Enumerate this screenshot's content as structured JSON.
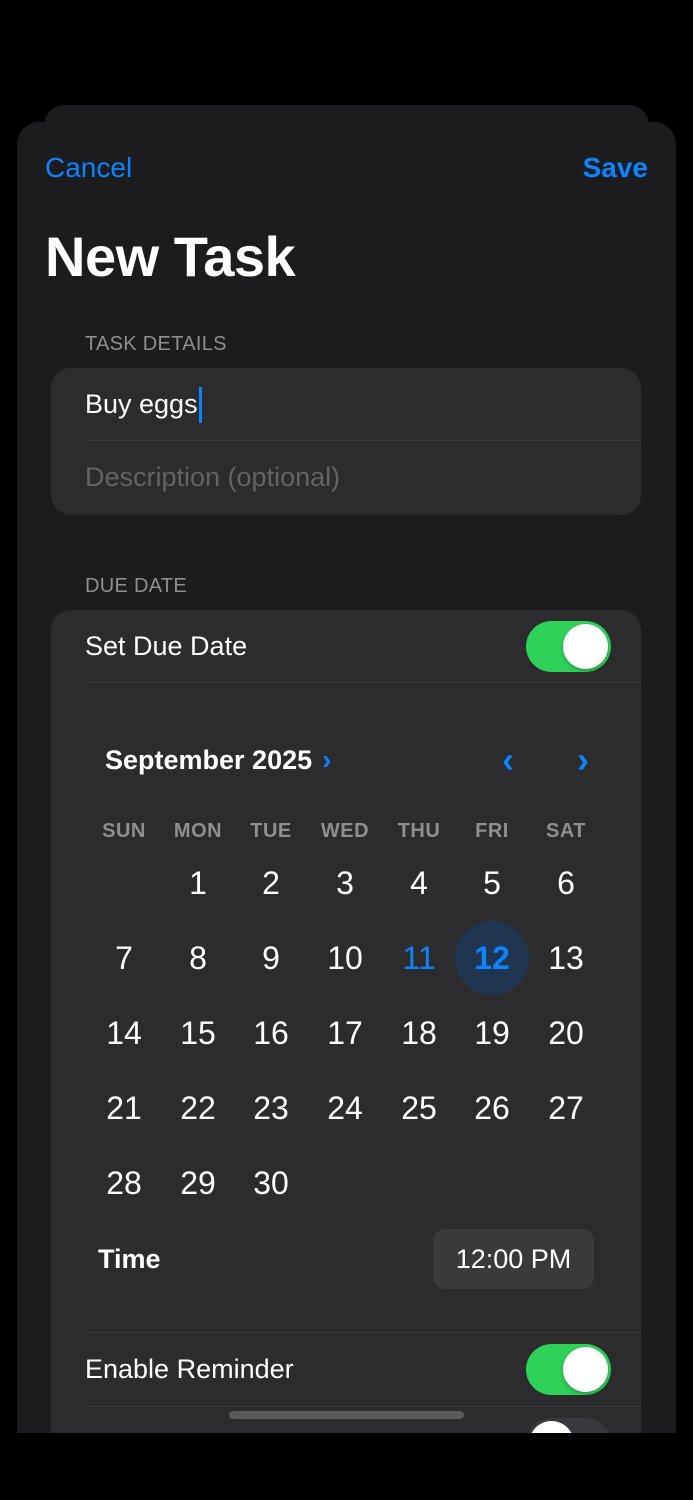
{
  "nav": {
    "cancel_label": "Cancel",
    "save_label": "Save"
  },
  "title": "New Task",
  "task_details": {
    "header": "TASK DETAILS",
    "title_value": "Buy eggs",
    "description_placeholder": "Description (optional)"
  },
  "due_date": {
    "header": "DUE DATE",
    "set_due_date_label": "Set Due Date",
    "set_due_date_on": true,
    "month_label": "September 2025",
    "weekdays": [
      "SUN",
      "MON",
      "TUE",
      "WED",
      "THU",
      "FRI",
      "SAT"
    ],
    "first_weekday_index": 1,
    "days_in_month": 30,
    "today": 11,
    "selected": 12,
    "time_label": "Time",
    "time_value": "12:00 PM"
  },
  "reminder": {
    "label": "Enable Reminder",
    "on": true
  },
  "colors": {
    "accent": "#0a84ff",
    "toggle_on": "#30d158",
    "background": "#1c1c1e",
    "card": "#2c2c2e"
  }
}
